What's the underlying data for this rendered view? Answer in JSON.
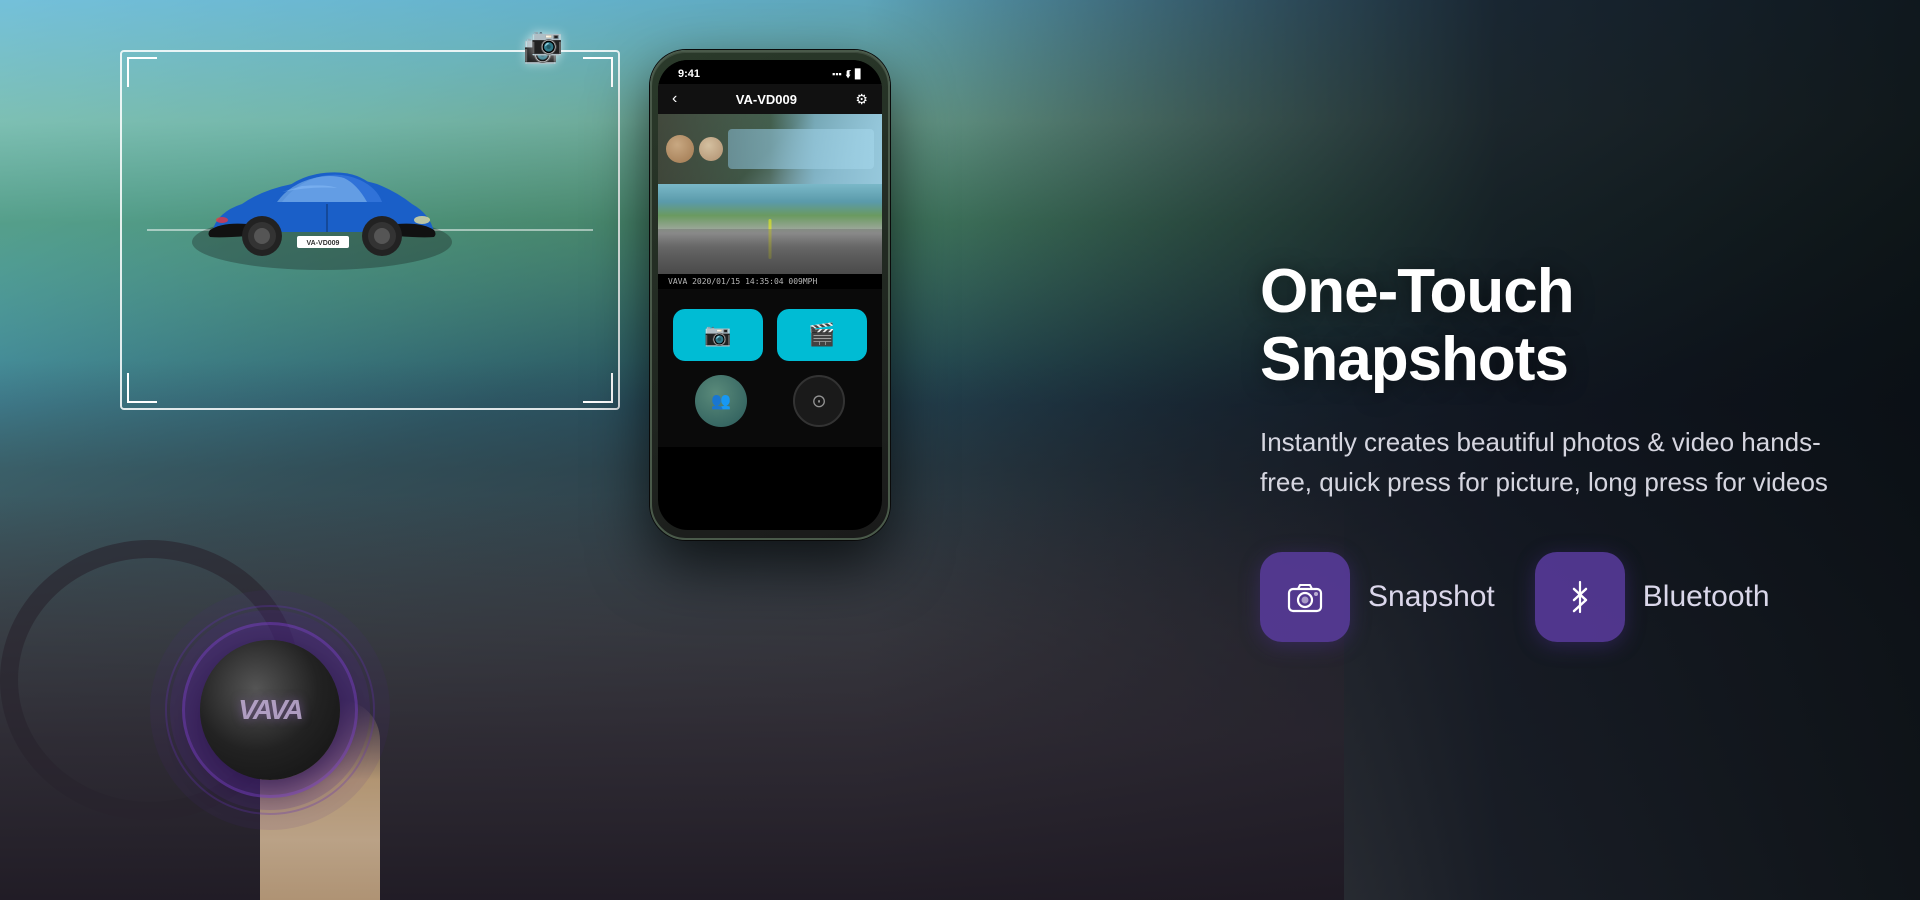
{
  "scene": {
    "background": {
      "description": "Car dashboard driving scene with road and sky"
    }
  },
  "car_frame": {
    "license_plate": "VA-VD009",
    "camera_icon": "📷"
  },
  "phone": {
    "status_bar": {
      "time": "9:41",
      "signal": "●●●",
      "wifi": "WiFi",
      "battery": "█████"
    },
    "header": {
      "back_label": "‹",
      "title": "VA-VD009",
      "settings_icon": "⚙"
    },
    "timestamp": "VAVA 2020/01/15  14:35:04  009MPH",
    "controls": {
      "snapshot_icon": "📷",
      "video_icon": "🎥"
    }
  },
  "heading": {
    "title": "One-Touch Snapshots",
    "description": "Instantly creates beautiful photos & video hands-free, quick press for picture, long press for videos"
  },
  "features": [
    {
      "id": "snapshot",
      "label": "Snapshot",
      "icon_type": "camera"
    },
    {
      "id": "bluetooth",
      "label": "Bluetooth",
      "icon_type": "bluetooth"
    }
  ],
  "remote": {
    "logo": "VAVA"
  },
  "colors": {
    "accent_purple": "#6a3db8",
    "badge_bg": "rgba(90,60,160,0.85)",
    "cyan_btn": "#00bcd4",
    "text_primary": "#ffffff",
    "text_secondary": "rgba(230,225,245,0.95)"
  }
}
